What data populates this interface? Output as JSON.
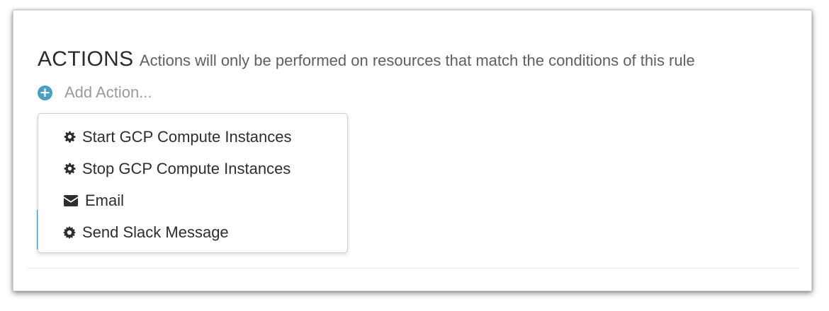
{
  "section": {
    "title": "ACTIONS",
    "subtitle": "Actions will only be performed on resources that match the conditions of this rule"
  },
  "add_action": {
    "icon": "plus-circle-icon",
    "label": "Add Action..."
  },
  "colors": {
    "accent": "#4a9ec4",
    "text": "#2e2e2e",
    "muted": "#9a9a9a"
  },
  "dropdown": {
    "items": [
      {
        "icon": "gear-icon",
        "label": "Start GCP Compute Instances"
      },
      {
        "icon": "gear-icon",
        "label": "Stop GCP Compute Instances"
      },
      {
        "icon": "envelope-icon",
        "label": "Email"
      },
      {
        "icon": "gear-icon",
        "label": "Send Slack Message"
      }
    ]
  }
}
